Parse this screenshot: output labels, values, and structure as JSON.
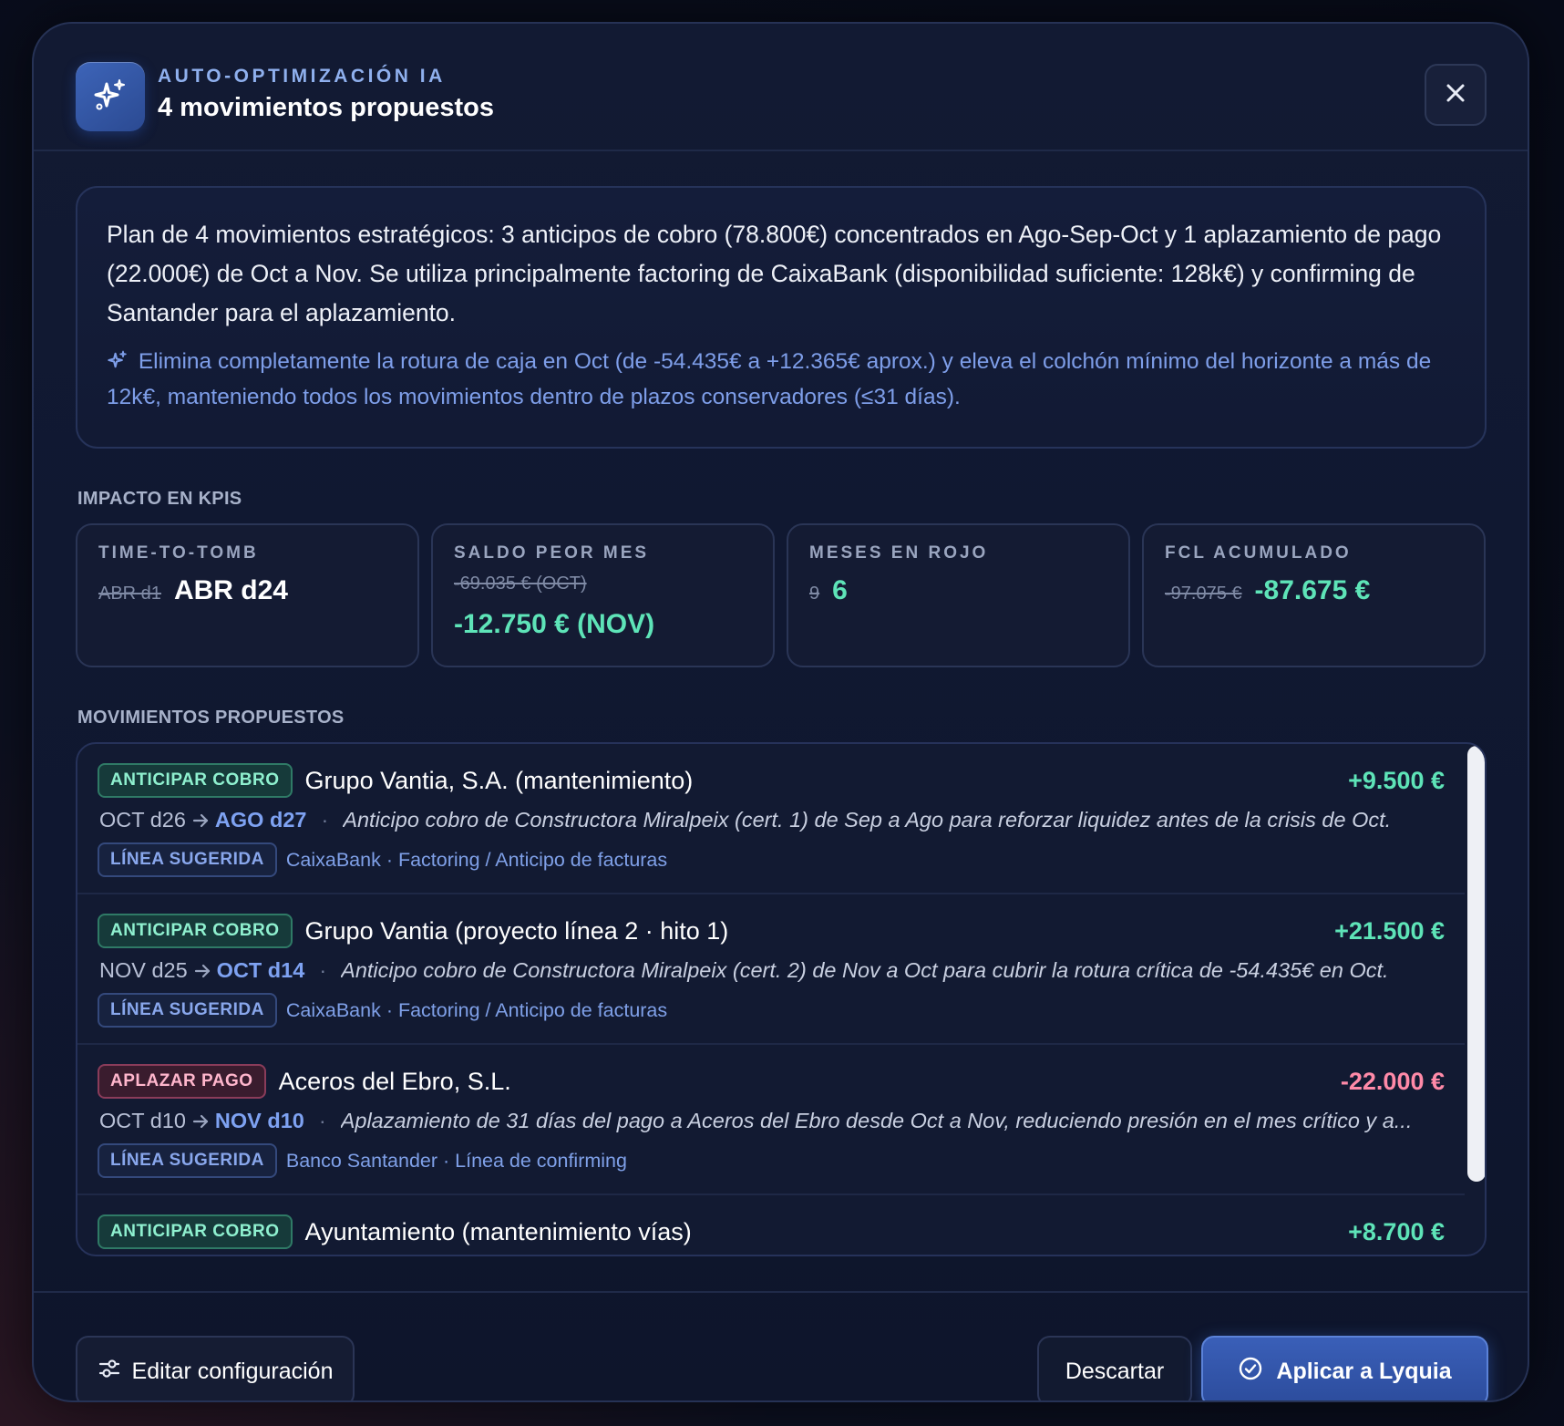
{
  "header": {
    "eyebrow": "AUTO-OPTIMIZACIÓN IA",
    "title": "4 movimientos propuestos",
    "logo_icon": "sparkles-icon",
    "close_icon": "close-icon"
  },
  "summary": {
    "text": "Plan de 4 movimientos estratégicos: 3 anticipos de cobro (78.800€) concentrados en Ago-Sep-Oct y 1 aplazamiento de pago (22.000€) de Oct a Nov. Se utiliza principalmente factoring de CaixaBank (disponibilidad suficiente: 128k€) y confirming de Santander para el aplazamiento.",
    "highlight": "Elimina completamente la rotura de caja en Oct (de -54.435€ a +12.365€ aprox.) y eleva el colchón mínimo del horizonte a más de 12k€, manteniendo todos los movimientos dentro de plazos conservadores (≤31 días)."
  },
  "kpis_label": "IMPACTO EN KPIS",
  "kpis": [
    {
      "label": "TIME-TO-TOMB",
      "old": "ABR d1",
      "new": "ABR d24"
    },
    {
      "label": "SALDO PEOR MES",
      "old": "-69.035 € (OCT)",
      "new": "-12.750 € (NOV)"
    },
    {
      "label": "MESES EN ROJO",
      "old": "9",
      "new": "6"
    },
    {
      "label": "FCL ACUMULADO",
      "old": "-97.075 €",
      "new": "-87.675 €"
    }
  ],
  "movements_label": "MOVIMIENTOS PROPUESTOS",
  "suggested_line_label": "LÍNEA SUGERIDA",
  "movements": [
    {
      "type": "ANTICIPAR COBRO",
      "name": "Grupo Vantia, S.A. (mantenimiento)",
      "amount": "+9.500 €",
      "from": "OCT d26",
      "to": "AGO d27",
      "description": "Anticipo cobro de Constructora Miralpeix (cert. 1) de Sep a Ago para reforzar liquidez antes de la crisis de Oct.",
      "line": "CaixaBank · Factoring / Anticipo de facturas"
    },
    {
      "type": "ANTICIPAR COBRO",
      "name": "Grupo Vantia (proyecto línea 2 · hito 1)",
      "amount": "+21.500 €",
      "from": "NOV d25",
      "to": "OCT d14",
      "description": "Anticipo cobro de Constructora Miralpeix (cert. 2) de Nov a Oct para cubrir la rotura crítica de -54.435€ en Oct.",
      "line": "CaixaBank · Factoring / Anticipo de facturas"
    },
    {
      "type": "APLAZAR PAGO",
      "name": "Aceros del Ebro, S.L.",
      "amount": "-22.000 €",
      "from": "OCT d10",
      "to": "NOV d10",
      "description": "Aplazamiento de 31 días del pago a Aceros del Ebro desde Oct a Nov, reduciendo presión en el mes crítico y a...",
      "line": "Banco Santander · Línea de confirming"
    },
    {
      "type": "ANTICIPAR COBRO",
      "name": "Ayuntamiento (mantenimiento vías)",
      "amount": "+8.700 €"
    }
  ],
  "footer": {
    "edit_label": "Editar configuración",
    "discard_label": "Descartar",
    "apply_label": "Aplicar a Lyquia"
  },
  "colors": {
    "accent_green": "#5ee4b8",
    "accent_blue": "#7ea2f2",
    "negative": "#ff8aa8"
  }
}
